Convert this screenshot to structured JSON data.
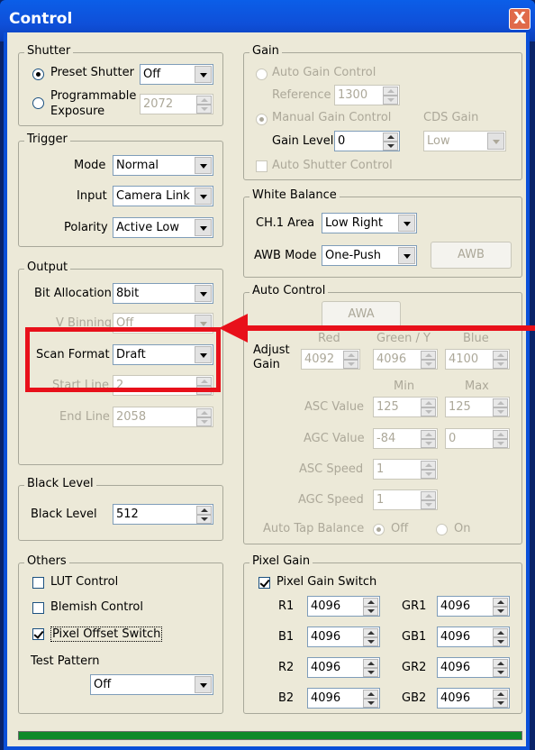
{
  "window": {
    "title": "Control",
    "close_glyph": "X"
  },
  "shutter": {
    "label": "Shutter",
    "preset_label": "Preset Shutter",
    "preset_value": "Off",
    "programmable_label_1": "Programmable",
    "programmable_label_2": "Exposure",
    "programmable_value": "2072"
  },
  "trigger": {
    "label": "Trigger",
    "mode_label": "Mode",
    "mode_value": "Normal",
    "input_label": "Input",
    "input_value": "Camera Link",
    "polarity_label": "Polarity",
    "polarity_value": "Active Low"
  },
  "output": {
    "label": "Output",
    "bit_label": "Bit Allocation",
    "bit_value": "8bit",
    "vbinning_label": "V Binning",
    "vbinning_value": "Off",
    "scan_label": "Scan Format",
    "scan_value": "Draft",
    "start_label": "Start Line",
    "start_value": "2",
    "end_label": "End Line",
    "end_value": "2058"
  },
  "black_level": {
    "label": "Black Level",
    "field_label": "Black Level",
    "value": "512"
  },
  "others": {
    "label": "Others",
    "lut": "LUT Control",
    "blemish": "Blemish Control",
    "pixel_offset": "Pixel Offset Switch",
    "test_pattern_label": "Test Pattern",
    "test_pattern_value": "Off"
  },
  "gain": {
    "label": "Gain",
    "auto_label": "Auto Gain Control",
    "reference_label": "Reference",
    "reference_value": "1300",
    "manual_label": "Manual Gain Control",
    "cds_label": "CDS Gain",
    "level_label": "Gain Level",
    "level_value": "0",
    "cds_value": "Low",
    "auto_shutter_label": "Auto Shutter Control"
  },
  "white_balance": {
    "label": "White Balance",
    "area_label": "CH.1 Area",
    "area_value": "Low Right",
    "awb_mode_label": "AWB Mode",
    "awb_mode_value": "One-Push",
    "awb_button": "AWB"
  },
  "auto_control": {
    "label": "Auto Control",
    "awa_button": "AWA",
    "red": "Red",
    "green": "Green / Y",
    "blue": "Blue",
    "adjust_1": "Adjust",
    "adjust_2": "Gain",
    "red_value": "4092",
    "green_value": "4096",
    "blue_value": "4100",
    "min": "Min",
    "max": "Max",
    "asc_value_label": "ASC Value",
    "asc_min": "125",
    "asc_max": "125",
    "agc_value_label": "AGC Value",
    "agc_min": "-84",
    "agc_max": "0",
    "asc_speed_label": "ASC Speed",
    "asc_speed": "1",
    "agc_speed_label": "AGC Speed",
    "agc_speed": "1",
    "tap_label": "Auto Tap Balance",
    "tap_off": "Off",
    "tap_on": "On"
  },
  "pixel_gain": {
    "label": "Pixel Gain",
    "switch_label": "Pixel Gain Switch",
    "r1_label": "R1",
    "r1": "4096",
    "gr1_label": "GR1",
    "gr1": "4096",
    "b1_label": "B1",
    "b1": "4096",
    "gb1_label": "GB1",
    "gb1": "4096",
    "r2_label": "R2",
    "r2": "4096",
    "gr2_label": "GR2",
    "gr2": "4096",
    "b2_label": "B2",
    "b2": "4096",
    "gb2_label": "GB2",
    "gb2": "4096"
  },
  "colors": {
    "title_bar": "#0f4fd8",
    "face": "#ece9d8",
    "highlight": "#e8101a",
    "progress": "#0e8a2a"
  }
}
